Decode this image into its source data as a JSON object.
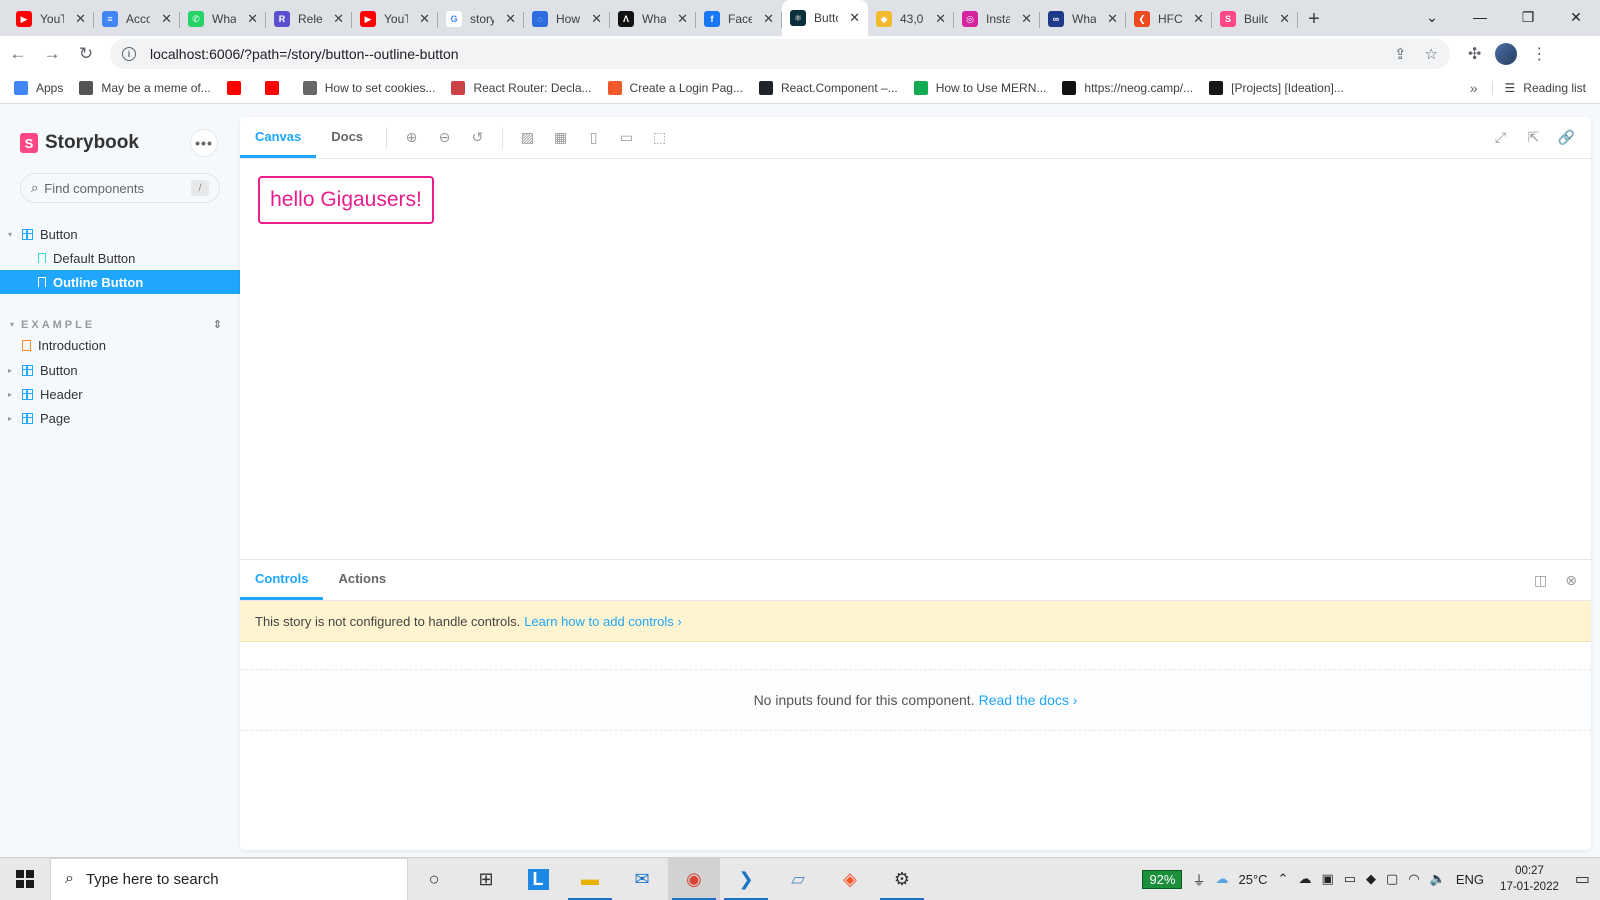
{
  "browser": {
    "tabs": [
      {
        "label": "YouTube",
        "fav_color": "#ff0000",
        "glyph": "▶"
      },
      {
        "label": "Account",
        "fav_color": "#4285f4",
        "glyph": "≡"
      },
      {
        "label": "WhatsApp",
        "fav_color": "#25d366",
        "glyph": "✆"
      },
      {
        "label": "Release",
        "fav_color": "#5a4fcf",
        "glyph": "R"
      },
      {
        "label": "YouTube",
        "fav_color": "#ff0000",
        "glyph": "▶"
      },
      {
        "label": "storybook",
        "fav_color": "#ffffff",
        "glyph": "G"
      },
      {
        "label": "How",
        "fav_color": "#2d6cdf",
        "glyph": "◌"
      },
      {
        "label": "What",
        "fav_color": "#111111",
        "glyph": "Λ"
      },
      {
        "label": "Facebook",
        "fav_color": "#1877f2",
        "glyph": "f"
      },
      {
        "label": "Button",
        "fav_color": "#0b2f3a",
        "glyph": "⚛",
        "active": true
      },
      {
        "label": "43,0",
        "fav_color": "#f3ba2f",
        "glyph": "◆"
      },
      {
        "label": "Instagram",
        "fav_color": "#d6249f",
        "glyph": "◎"
      },
      {
        "label": "What",
        "fav_color": "#1e3a8a",
        "glyph": "∞"
      },
      {
        "label": "HFC",
        "fav_color": "#ef4b23",
        "glyph": "❮"
      },
      {
        "label": "Build",
        "fav_color": "#ff4785",
        "glyph": "S"
      }
    ],
    "url": "localhost:6006/?path=/story/button--outline-button",
    "bookmarks": [
      {
        "label": "Apps",
        "color": "#4285f4"
      },
      {
        "label": "May be a meme of...",
        "color": "#555555"
      },
      {
        "label": "",
        "color": "#ff0000"
      },
      {
        "label": "",
        "color": "#ff0000"
      },
      {
        "label": "How to set cookies...",
        "color": "#666666"
      },
      {
        "label": "React Router: Decla...",
        "color": "#ca4245"
      },
      {
        "label": "Create a Login Pag...",
        "color": "#f05a28"
      },
      {
        "label": "React.Component –...",
        "color": "#20232a"
      },
      {
        "label": "How to Use MERN...",
        "color": "#13aa52"
      },
      {
        "label": "https://neog.camp/...",
        "color": "#111111"
      },
      {
        "label": "[Projects] [Ideation]...",
        "color": "#181717"
      }
    ],
    "more": "»",
    "reading_list": "Reading list"
  },
  "storybook": {
    "brand": "Storybook",
    "menu": "•••",
    "search_placeholder": "Find components",
    "search_shortcut": "/",
    "tree": {
      "root_component": "Button",
      "stories": [
        "Default Button",
        "Outline Button"
      ],
      "selected": "Outline Button"
    },
    "section": {
      "title": "EXAMPLE",
      "items": [
        "Introduction",
        "Button",
        "Header",
        "Page"
      ]
    },
    "toolbar_tabs": [
      "Canvas",
      "Docs"
    ],
    "preview_button_text": "hello Gigausers!",
    "addon_tabs": [
      "Controls",
      "Actions"
    ],
    "notice_text": "This story is not configured to handle controls.",
    "notice_link": "Learn how to add controls ›",
    "empty_text": "No inputs found for this component.",
    "empty_link": "Read the docs ›"
  },
  "taskbar": {
    "search_placeholder": "Type here to search",
    "battery": "92%",
    "weather": "25°C",
    "language": "ENG",
    "time": "00:27",
    "date": "17-01-2022"
  },
  "colors": {
    "accent": "#1ea7fd",
    "storybook_pink": "#ff4785",
    "preview_button": "#e91e8c",
    "notice_bg": "#fff4cf"
  }
}
